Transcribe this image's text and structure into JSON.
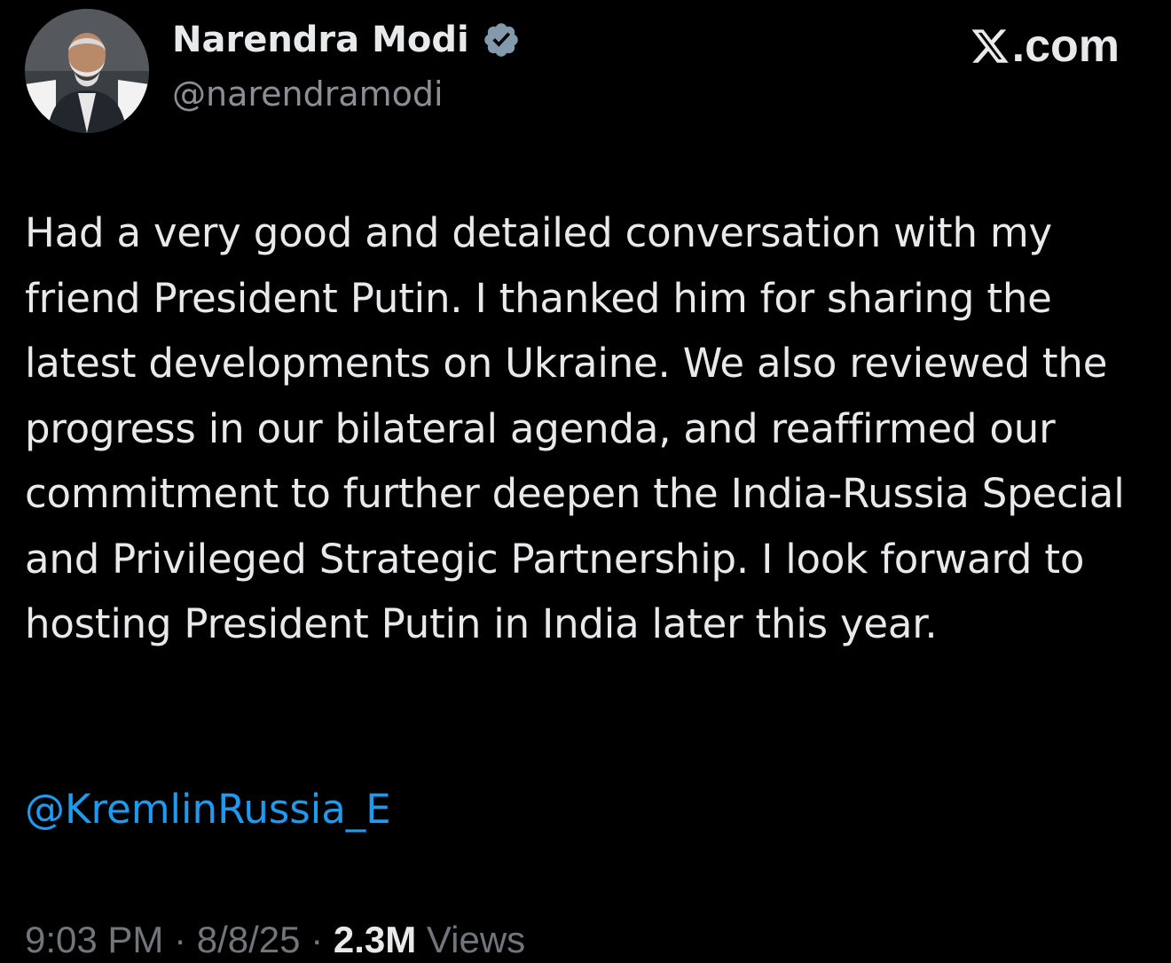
{
  "author": {
    "name": "Narendra Modi",
    "handle": "@narendramodi",
    "verified": true
  },
  "brand": {
    "label": ".com",
    "icon": "x-logo-icon"
  },
  "tweet": {
    "text": "Had a very good and detailed conversation with my friend President Putin. I thanked him for sharing the latest developments on Ukraine. We also reviewed the progress in our bilateral agenda, and reaffirmed our commitment to further deepen the India-Russia Special and Privileged Strategic Partnership. I look forward to hosting President Putin in India later this year.",
    "mention": "@KremlinRussia_E"
  },
  "meta": {
    "time": "9:03 PM",
    "separator": " · ",
    "date": "8/8/25",
    "views_count": "2.3M",
    "views_label": "Views"
  },
  "colors": {
    "background": "#000000",
    "text": "#e7e9ea",
    "secondary": "#71767b",
    "link": "#1d9bf0",
    "verified_badge": "#829aab"
  }
}
